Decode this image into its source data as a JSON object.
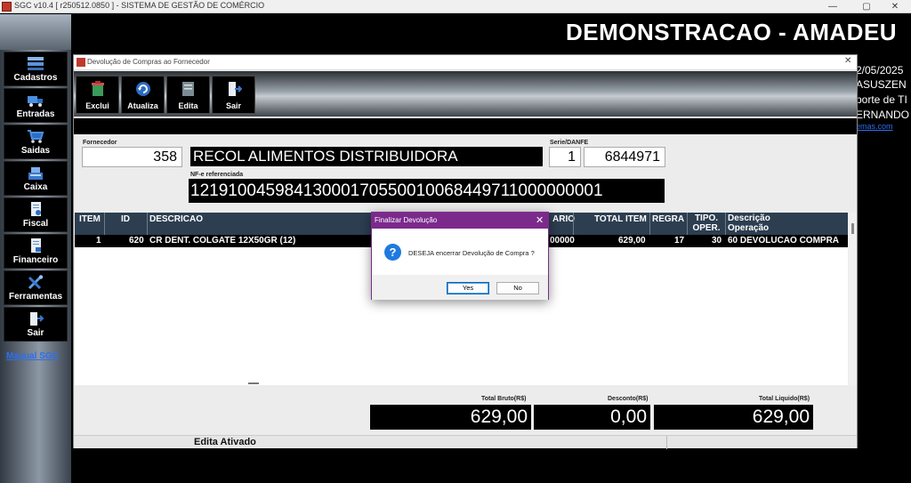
{
  "window": {
    "title": "SGC v10.4 [ r250512.0850 ] - SISTEMA DE GESTÃO DE COMÉRCIO",
    "min": "—",
    "max": "▢",
    "close": "✕"
  },
  "sidebar": {
    "items": [
      {
        "label": "Cadastros",
        "icon": "grid-icon"
      },
      {
        "label": "Entradas",
        "icon": "truck-icon"
      },
      {
        "label": "Saidas",
        "icon": "cart-icon"
      },
      {
        "label": "Caixa",
        "icon": "register-icon"
      },
      {
        "label": "Fiscal",
        "icon": "document-icon"
      },
      {
        "label": "Financeiro",
        "icon": "document-icon"
      },
      {
        "label": "Ferramentas",
        "icon": "tools-icon"
      },
      {
        "label": "Sair",
        "icon": "door-exit-icon"
      }
    ],
    "manual": "Manual SGC"
  },
  "banner": "DEMONSTRACAO - AMADEU",
  "right_info": [
    "2/05/2025",
    "ASUSZEN",
    "porte de TI",
    "ERNANDO",
    "emas.com"
  ],
  "dialog": {
    "title": "Devolução de Compras ao Fornecedor",
    "toolbar": [
      {
        "label": "Exclui",
        "icon": "delete-icon"
      },
      {
        "label": "Atualiza",
        "icon": "refresh-icon"
      },
      {
        "label": "Edita",
        "icon": "edit-icon"
      },
      {
        "label": "Sair",
        "icon": "exit-icon"
      }
    ],
    "fornecedor_label": "Fornecedor",
    "fornecedor_code": "358",
    "fornecedor_name": "RECOL ALIMENTOS DISTRIBUIDORA",
    "serie_label": "Serie/DANFE",
    "serie": "1",
    "danfe": "6844971",
    "nfe_label": "NF-e referenciada",
    "nfe": "12191004598413000170550010068449711000000001",
    "grid": {
      "columns": [
        "ITEM",
        "ID",
        "DESCRICAO",
        "ARIO",
        "TOTAL ITEM",
        "REGRA",
        "TIPO. OPER.",
        "Descrição Operação"
      ],
      "rows": [
        {
          "item": "1",
          "id": "620",
          "descricao": "CR DENT. COLGATE 12X50GR (12)",
          "unit": "00000",
          "total": "629,00",
          "regra": "17",
          "tipo": "30",
          "descop": "60 DEVOLUCAO COMPRA"
        }
      ]
    },
    "totals": {
      "bruto_label": "Total Bruto(R$)",
      "bruto": "629,00",
      "desconto_label": "Desconto(R$)",
      "desconto": "0,00",
      "liquido_label": "Total Liquido(R$)",
      "liquido": "629,00"
    },
    "status": "Edita Ativado"
  },
  "messagebox": {
    "title": "Finalizar Devolução",
    "icon": "question-icon",
    "text": "DESEJA encerrar Devolução de Compra ?",
    "yes": "Yes",
    "no": "No",
    "close": "✕"
  },
  "colors": {
    "accent": "#7b2a8c",
    "grid_header": "#2c3e50",
    "link": "#2e6ef0"
  }
}
